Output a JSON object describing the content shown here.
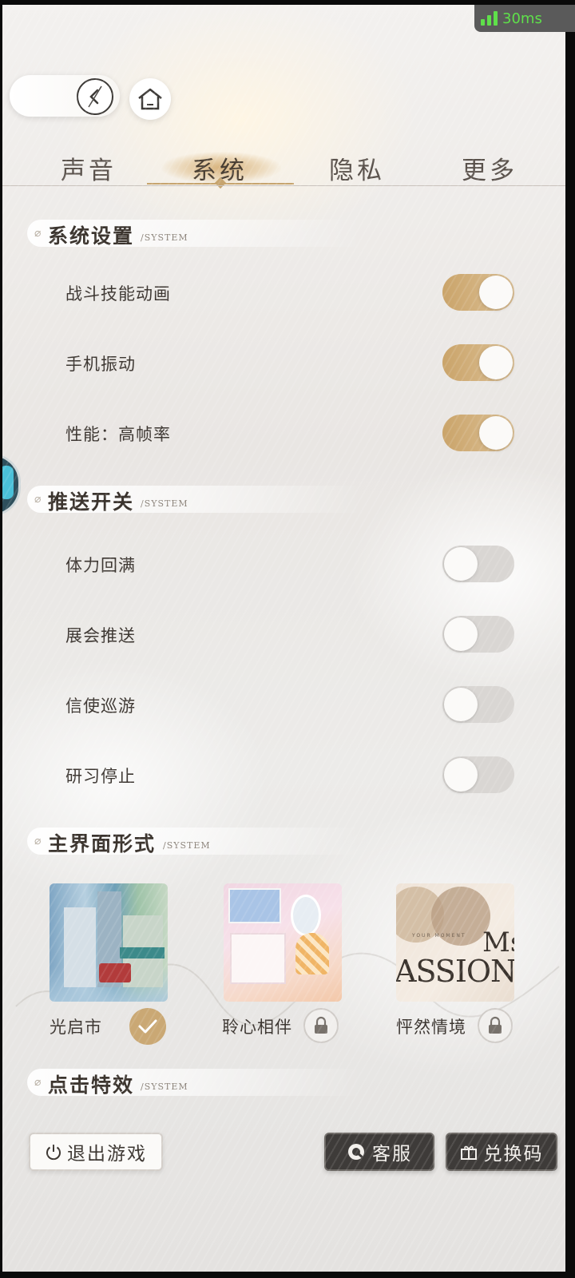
{
  "status": {
    "ping": "30ms"
  },
  "tabs": [
    {
      "label": "声音",
      "active": false
    },
    {
      "label": "系统",
      "active": true
    },
    {
      "label": "隐私",
      "active": false
    },
    {
      "label": "更多",
      "active": false
    }
  ],
  "sections": {
    "system_settings": {
      "title": "系统设置",
      "sub": "/SYSTEM"
    },
    "push": {
      "title": "推送开关",
      "sub": "/SYSTEM"
    },
    "main_ui": {
      "title": "主界面形式",
      "sub": "/SYSTEM"
    },
    "click_fx": {
      "title": "点击特效",
      "sub": "/SYSTEM"
    }
  },
  "system_settings": [
    {
      "label": "战斗技能动画",
      "on": true
    },
    {
      "label": "手机振动",
      "on": true
    },
    {
      "label": "性能：高帧率",
      "on": true
    }
  ],
  "push": [
    {
      "label": "体力回满",
      "on": false
    },
    {
      "label": "展会推送",
      "on": false
    },
    {
      "label": "信使巡游",
      "on": false
    },
    {
      "label": "研习停止",
      "on": false
    }
  ],
  "themes": [
    {
      "label": "光启市",
      "state": "selected"
    },
    {
      "label": "聆心相伴",
      "state": "locked"
    },
    {
      "label": "怦然情境",
      "state": "locked",
      "art_small": "YOUR MOMENT",
      "art_big": "ASSION",
      "art_corner": "Ms"
    }
  ],
  "buttons": {
    "exit": "退出游戏",
    "support": "客服",
    "redeem": "兑换码"
  },
  "colors": {
    "accent_gold": "#caa46a",
    "toggle_off": "#d9d6d3",
    "ping_green": "#5fe04a",
    "dark_button": "#3e3b39"
  }
}
